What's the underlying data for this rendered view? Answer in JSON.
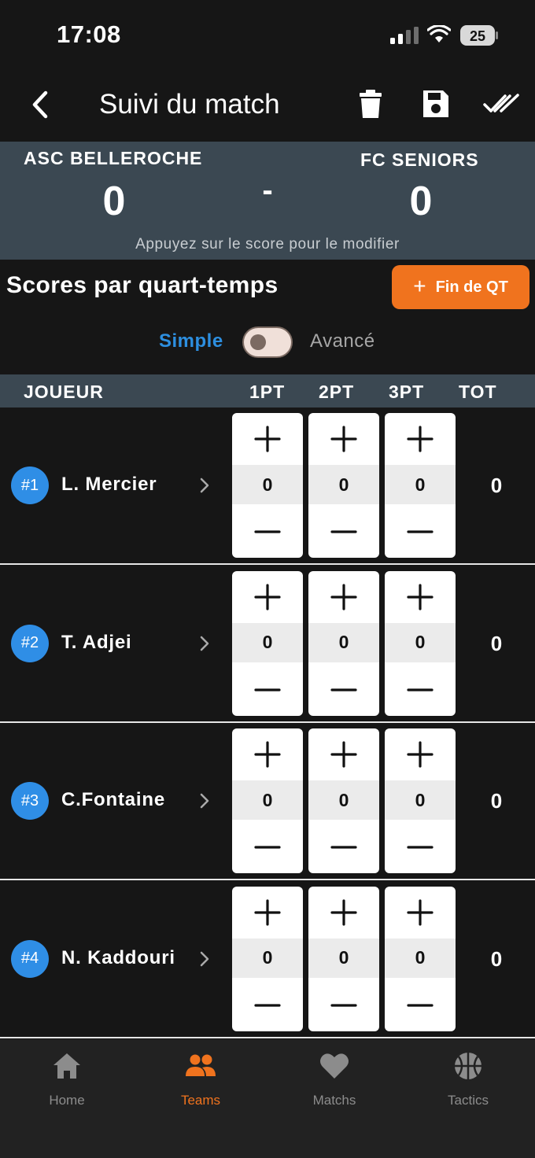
{
  "status_bar": {
    "time": "17:08",
    "battery": "25"
  },
  "header": {
    "title": "Suivi du match"
  },
  "score": {
    "team_a": "ASC BELLEROCHE",
    "team_b": "FC SENIORS",
    "score_a": "0",
    "score_b": "0",
    "separator": "-",
    "hint": "Appuyez sur le score pour le modifier"
  },
  "section": {
    "title": "Scores par quart-temps",
    "end_quarter_label": "Fin de QT"
  },
  "mode_toggle": {
    "simple_label": "Simple",
    "advanced_label": "Avancé",
    "advanced_on": false
  },
  "table": {
    "headers": {
      "player": "JOUEUR",
      "pt1": "1PT",
      "pt2": "2PT",
      "pt3": "3PT",
      "tot": "TOT"
    },
    "players": [
      {
        "number": "#1",
        "name": "L. Mercier",
        "pt1": "0",
        "pt2": "0",
        "pt3": "0",
        "tot": "0"
      },
      {
        "number": "#2",
        "name": "T. Adjei",
        "pt1": "0",
        "pt2": "0",
        "pt3": "0",
        "tot": "0"
      },
      {
        "number": "#3",
        "name": "C.Fontaine",
        "pt1": "0",
        "pt2": "0",
        "pt3": "0",
        "tot": "0"
      },
      {
        "number": "#4",
        "name": "N. Kaddouri",
        "pt1": "0",
        "pt2": "0",
        "pt3": "0",
        "tot": "0"
      }
    ]
  },
  "tabbar": {
    "items": [
      {
        "label": "Home",
        "icon": "home-icon"
      },
      {
        "label": "Teams",
        "icon": "team-icon"
      },
      {
        "label": "Matchs",
        "icon": "heart-icon"
      },
      {
        "label": "Tactics",
        "icon": "basketball-icon"
      }
    ],
    "active": "Teams"
  },
  "colors": {
    "accent": "#f0731e",
    "link_blue": "#2d8fe0",
    "banner": "#3b4852",
    "background": "#161616"
  }
}
